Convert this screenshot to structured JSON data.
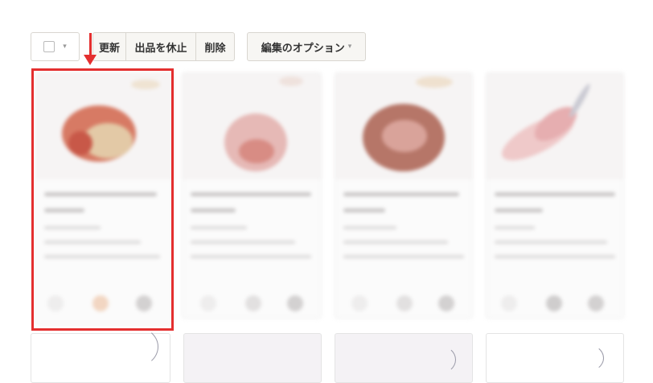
{
  "toolbar": {
    "select_caret": "▾",
    "update_label": "更新",
    "pause_label": "出品を休止",
    "delete_label": "削除",
    "options_label": "編集のオプション",
    "options_caret": "▾"
  },
  "colors": {
    "highlight": "#e42f2f",
    "button_bg": "#f7f6f3",
    "button_border": "#d9d6d0"
  },
  "icons": [
    "checkbox-icon",
    "chevron-down-icon",
    "arrow-down-icon"
  ],
  "listings": {
    "visible_row1": 4,
    "visible_row2": 4,
    "blurred": true
  }
}
